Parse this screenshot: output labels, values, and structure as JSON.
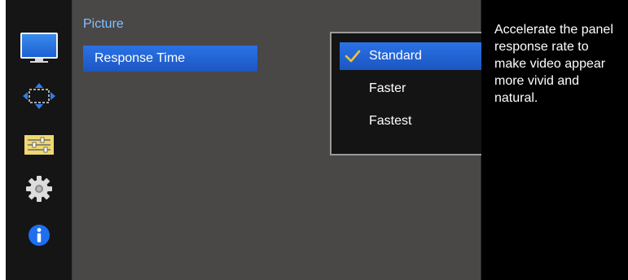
{
  "sidebar": {
    "items": [
      {
        "icon": "monitor-icon",
        "active": true
      },
      {
        "icon": "resize-arrows-icon",
        "active": false
      },
      {
        "icon": "adjustment-sliders-icon",
        "active": false
      },
      {
        "icon": "gear-icon",
        "active": false
      },
      {
        "icon": "info-icon",
        "active": false
      }
    ]
  },
  "main": {
    "section_title": "Picture",
    "menu_item": "Response Time"
  },
  "dropdown": {
    "options": [
      {
        "label": "Standard",
        "selected": true
      },
      {
        "label": "Faster",
        "selected": false
      },
      {
        "label": "Fastest",
        "selected": false
      }
    ]
  },
  "description": {
    "text": "Accelerate the panel response rate to make video appear more vivid and natural."
  },
  "colors": {
    "highlight": "#2a72e6",
    "section_title": "#7fc2ff",
    "panel_bg": "#4a4747",
    "check": "#f2c230"
  }
}
